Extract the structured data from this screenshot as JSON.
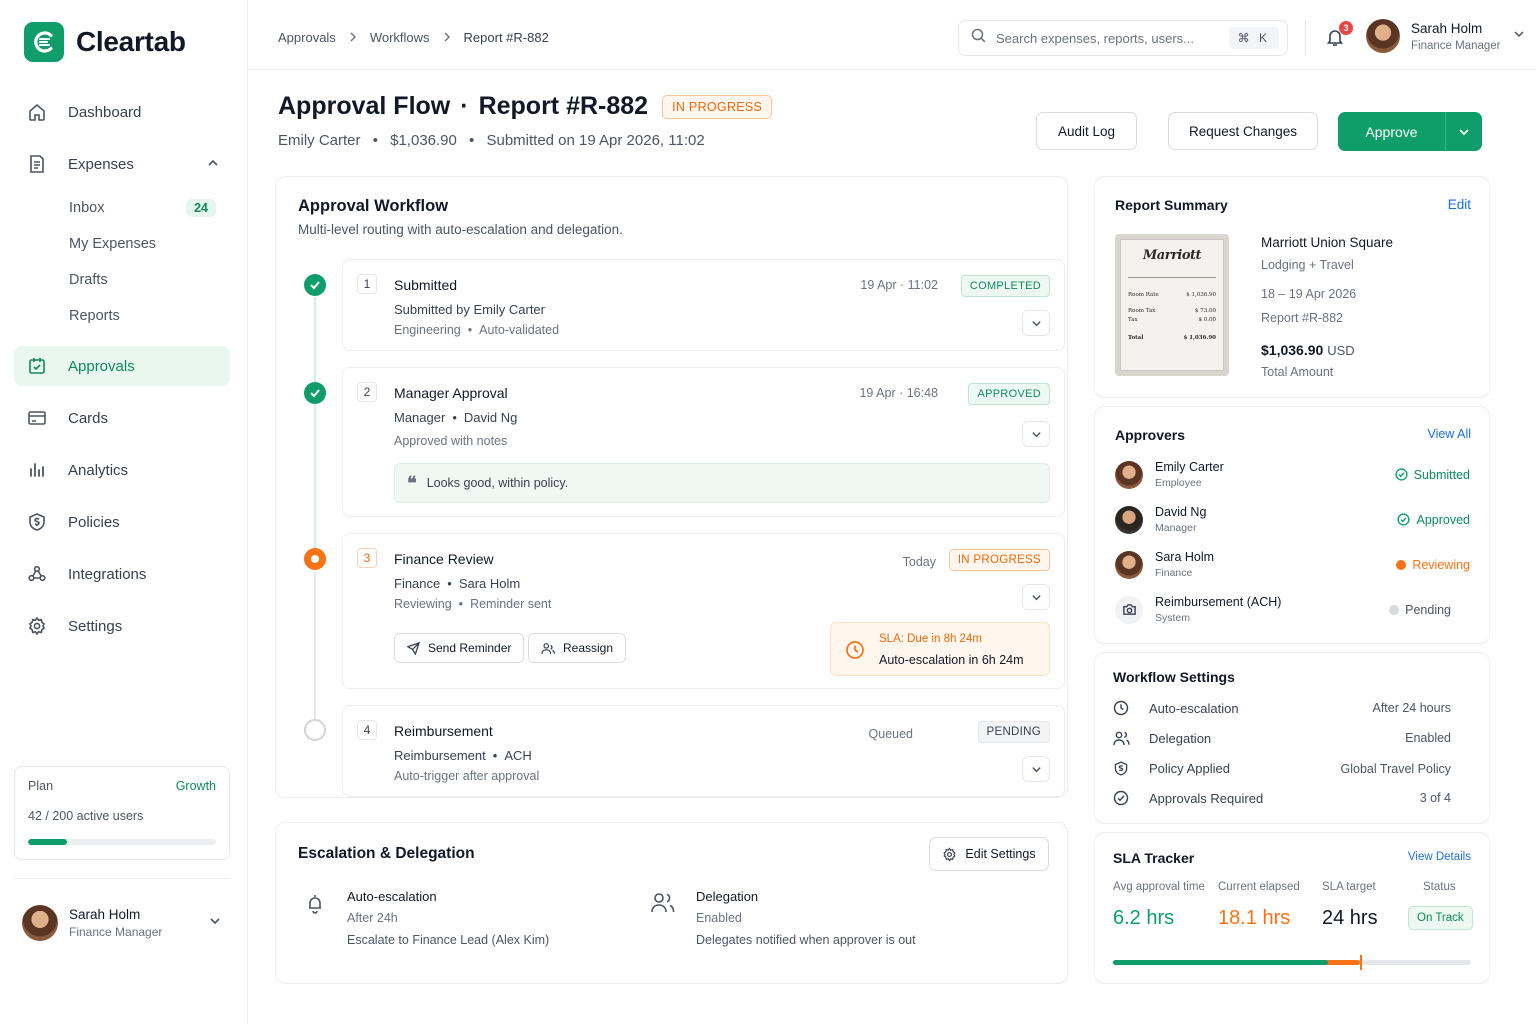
{
  "brand": {
    "name": "Cleartab",
    "accent": "#0f9d6b"
  },
  "sidebar": {
    "items": [
      {
        "label": "Dashboard",
        "icon": "home-icon"
      },
      {
        "label": "Expenses",
        "icon": "receipt-icon"
      },
      {
        "label": "Approvals",
        "icon": "calendar-check-icon"
      },
      {
        "label": "Cards",
        "icon": "credit-card-icon"
      },
      {
        "label": "Analytics",
        "icon": "bar-chart-icon"
      },
      {
        "label": "Policies",
        "icon": "shield-dollar-icon"
      },
      {
        "label": "Integrations",
        "icon": "nodes-icon"
      },
      {
        "label": "Settings",
        "icon": "gear-icon"
      }
    ],
    "expenses_sub": [
      {
        "label": "Inbox",
        "count": "24"
      },
      {
        "label": "My Expenses"
      },
      {
        "label": "Drafts"
      },
      {
        "label": "Reports"
      }
    ],
    "plan": {
      "label": "Plan",
      "tier": "Growth",
      "users": "42 / 200 active users",
      "usage_fraction": 0.21
    },
    "user": {
      "name": "Sarah Holm",
      "role": "Finance Manager"
    }
  },
  "topbar": {
    "breadcrumb": [
      "Approvals",
      "Workflows",
      "Report #R-882"
    ],
    "search_placeholder": "Search expenses, reports, users...",
    "shortcut": "⌘ K",
    "notifications": "3",
    "user": {
      "name": "Sarah Holm",
      "role": "Finance Manager"
    }
  },
  "header": {
    "title": "Approval Flow",
    "report": "Report #R-882",
    "status": "IN PROGRESS",
    "submitter": "Emily Carter",
    "amount": "$1,036.90",
    "submitted": "Submitted on 19 Apr 2026, 11:02",
    "buttons": {
      "audit": "Audit Log",
      "request": "Request Changes",
      "approve": "Approve"
    }
  },
  "workflow": {
    "title": "Approval Workflow",
    "subtitle": "Multi-level routing with auto-escalation and delegation.",
    "steps": [
      {
        "num": "1",
        "title": "Submitted",
        "line1": "Submitted by Emily Carter",
        "dept": "Engineering",
        "note": "Auto-validated",
        "time": "19 Apr · 11:02",
        "badge": "COMPLETED"
      },
      {
        "num": "2",
        "title": "Manager Approval",
        "role": "Manager",
        "person": "David Ng",
        "line2": "Approved with notes",
        "time": "19 Apr · 16:48",
        "badge": "APPROVED",
        "quote": "Looks good, within policy."
      },
      {
        "num": "3",
        "title": "Finance Review",
        "role": "Finance",
        "person": "Sara Holm",
        "state": "Reviewing",
        "note": "Reminder sent",
        "time": "Today",
        "badge": "IN PROGRESS",
        "actions": {
          "remind": "Send Reminder",
          "reassign": "Reassign"
        },
        "sla": {
          "due": "SLA: Due in 8h 24m",
          "escalation": "Auto-escalation in 6h 24m"
        }
      },
      {
        "num": "4",
        "title": "Reimbursement",
        "role": "Reimbursement",
        "method": "ACH",
        "line2": "Auto-trigger after approval",
        "time": "Queued",
        "badge": "PENDING"
      }
    ]
  },
  "escalation": {
    "title": "Escalation & Delegation",
    "edit": "Edit Settings",
    "auto": {
      "title": "Auto-escalation",
      "line1": "After 24h",
      "line2": "Escalate to Finance Lead (Alex Kim)"
    },
    "delegation": {
      "title": "Delegation",
      "line1": "Enabled",
      "line2": "Delegates notified when approver is out"
    }
  },
  "summary": {
    "title": "Report Summary",
    "edit": "Edit",
    "merchant": "Marriott Union Square",
    "category": "Lodging + Travel",
    "dates": "18 – 19 Apr 2026",
    "report": "Report #R-882",
    "amount": "$1,036.90",
    "currency": "USD",
    "amount_label": "Total Amount",
    "receipt": {
      "logo": "Marriott",
      "rows": [
        [
          "Room Rate",
          "$ 1,036.90"
        ],
        [
          "Room Tax",
          "$ 73.00"
        ],
        [
          "Tax",
          "$ 0.00"
        ],
        [
          "Total",
          "$ 1,036.90"
        ]
      ]
    }
  },
  "approvers": {
    "title": "Approvers",
    "view_all": "View All",
    "list": [
      {
        "name": "Emily Carter",
        "role": "Employee",
        "status": "Submitted",
        "color": "#0f8a5f"
      },
      {
        "name": "David Ng",
        "role": "Manager",
        "status": "Approved",
        "color": "#0f8a5f"
      },
      {
        "name": "Sara Holm",
        "role": "Finance",
        "status": "Reviewing",
        "color": "#f97316"
      },
      {
        "name": "Reimbursement (ACH)",
        "role": "System",
        "status": "Pending",
        "color": "#4b5563"
      }
    ]
  },
  "settings": {
    "title": "Workflow Settings",
    "rows": [
      {
        "label": "Auto-escalation",
        "value": "After 24 hours",
        "icon": "clock-icon"
      },
      {
        "label": "Delegation",
        "value": "Enabled",
        "icon": "users-icon"
      },
      {
        "label": "Policy Applied",
        "value": "Global Travel Policy",
        "icon": "shield-dollar-icon"
      },
      {
        "label": "Approvals Required",
        "value": "3 of 4",
        "icon": "check-circle-icon"
      }
    ]
  },
  "sla": {
    "title": "SLA Tracker",
    "details": "View Details",
    "cols": [
      {
        "label": "Avg approval time",
        "value": "6.2 hrs",
        "color": "#0f9d6b"
      },
      {
        "label": "Current elapsed",
        "value": "18.1 hrs",
        "color": "#f97316"
      },
      {
        "label": "SLA target",
        "value": "24 hrs",
        "color": "#111827"
      },
      {
        "label": "Status",
        "value": "On Track"
      }
    ],
    "avg_fraction": 0.6,
    "elapsed_fraction": 0.69
  }
}
